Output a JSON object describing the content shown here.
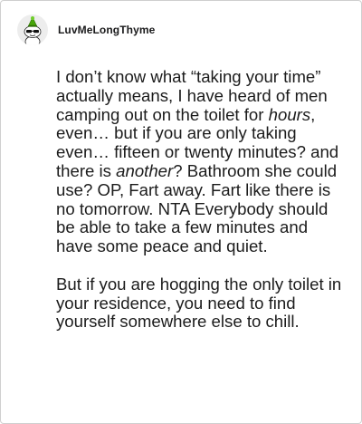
{
  "comment": {
    "author": "LuvMeLongThyme",
    "avatar_icon": "reddit-snoo-avatar-icon",
    "paragraph1": [
      {
        "t": "I don’t know what “taking your time” actually means, I have heard of men camping out on the toilet for ",
        "i": false
      },
      {
        "t": "hours",
        "i": true
      },
      {
        "t": ", even… but if you are only taking even… fifteen or twenty minutes? and there is ",
        "i": false
      },
      {
        "t": "another",
        "i": true
      },
      {
        "t": "? Bathroom she could use? OP, Fart away. Fart like there is no tomorrow. NTA Everybody should be able to take a few minutes and have some peace and quiet.",
        "i": false
      }
    ],
    "paragraph2": "But if you are hogging the only toilet in your residence, you need to find yourself somewhere else to chill."
  },
  "colors": {
    "text": "#1c1c1c",
    "border": "#cfcfcf",
    "avatar_bg": "#ededed",
    "snoo_hat": "#46a508"
  }
}
